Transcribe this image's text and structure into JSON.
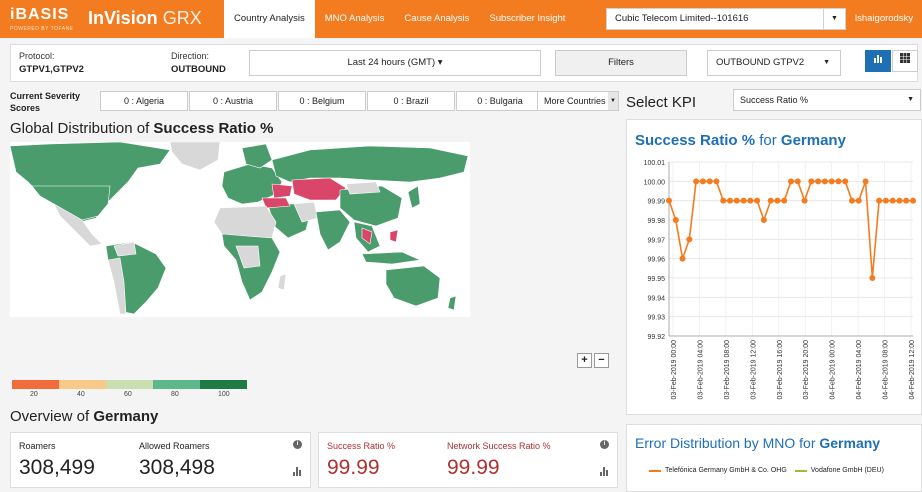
{
  "header": {
    "brand": "iBASIS",
    "brand_tagline": "POWERED BY TOFANE",
    "app_title_bold": "InVision",
    "app_title_light": "GRX",
    "nav": [
      "Country Analysis",
      "MNO Analysis",
      "Cause Analysis",
      "Subscriber Insight"
    ],
    "active_nav": "Country Analysis",
    "company": "Cubic Telecom Limited--101616",
    "user": "lshaigorodsky"
  },
  "filters": {
    "protocol_label": "Protocol:",
    "protocol_value": "GTPV1,GTPV2",
    "direction_label": "Direction:",
    "direction_value": "OUTBOUND",
    "time_range": "Last 24 hours  (GMT) ▾",
    "filters_button": "Filters",
    "protocol_select": "OUTBOUND GTPV2"
  },
  "severity": {
    "label": "Current Severity Scores",
    "chips": [
      "0 : Algeria",
      "0 : Austria",
      "0 : Belgium",
      "0 : Brazil",
      "0 : Bulgaria"
    ],
    "more": "More Countries"
  },
  "map": {
    "title_prefix": "Global Distribution of ",
    "title_bold": "Success Ratio %",
    "zoom_in": "+",
    "zoom_out": "−",
    "legend_colors": [
      "#f26b3a",
      "#f9c98a",
      "#c9dfb0",
      "#5cb88b",
      "#1f7a45"
    ],
    "legend_labels": [
      "20",
      "40",
      "60",
      "80",
      "100"
    ],
    "colors": {
      "good": "#4a9c6d",
      "bad": "#d9466a",
      "nodata": "#d8d8d8"
    }
  },
  "overview": {
    "title_prefix": "Overview of ",
    "country": "Germany",
    "roamers_label": "Roamers",
    "roamers_value": "308,499",
    "allowed_label": "Allowed Roamers",
    "allowed_value": "308,498",
    "success_label": "Success Ratio %",
    "success_value": "99.99",
    "network_label": "Network Success Ratio %",
    "network_value": "99.99"
  },
  "kpi": {
    "label": "Select KPI",
    "selected": "Success Ratio %"
  },
  "chart_title": {
    "bold_kpi": "Success Ratio %",
    "mid": " for ",
    "country": "Germany"
  },
  "chart_data": {
    "type": "line",
    "title": "Success Ratio % for Germany",
    "ylim": [
      99.92,
      100.01
    ],
    "yticks": [
      "100.01",
      "100.00",
      "99.99",
      "99.98",
      "99.97",
      "99.96",
      "99.95",
      "99.94",
      "99.93",
      "99.92"
    ],
    "xtick_labels": [
      "03-Feb-2019 00:00",
      "03-Feb-2019 04:00",
      "03-Feb-2019 08:00",
      "03-Feb-2019 12:00",
      "03-Feb-2019 16:00",
      "03-Feb-2019 20:00",
      "04-Feb-2019 00:00",
      "04-Feb-2019 04:00",
      "04-Feb-2019 08:00",
      "04-Feb-2019 12:00"
    ],
    "grid": true,
    "color": "#f47c20",
    "series": [
      {
        "values": [
          99.99,
          99.98,
          99.96,
          99.97,
          100.0,
          100.0,
          100.0,
          100.0,
          99.99,
          99.99,
          99.99,
          99.99,
          99.99,
          99.99,
          99.98,
          99.99,
          99.99,
          99.99,
          100.0,
          100.0,
          99.99,
          100.0,
          100.0,
          100.0,
          100.0,
          100.0,
          100.0,
          99.99,
          99.99,
          100.0,
          99.95,
          99.99,
          99.99,
          99.99,
          99.99,
          99.99,
          99.99
        ]
      }
    ]
  },
  "error_panel": {
    "title_prefix": "Error Distribution by MNO for ",
    "country": "Germany",
    "legend": [
      {
        "name": "Telefónica Germany GmbH & Co. OHG",
        "color": "#f47c20"
      },
      {
        "name": "Vodafone GmbH (DEU)",
        "color": "#9bbd3c"
      }
    ]
  }
}
